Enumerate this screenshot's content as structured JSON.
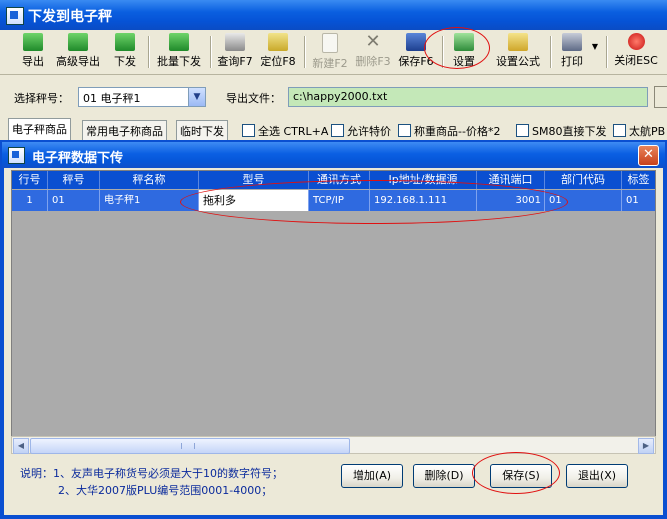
{
  "window": {
    "title": "下发到电子秤"
  },
  "toolbar": {
    "buttons": [
      {
        "label": "导出",
        "icon": "export-icon"
      },
      {
        "label": "高级导出",
        "icon": "advanced-export-icon"
      },
      {
        "label": "下发",
        "icon": "send-icon"
      },
      {
        "label": "批量下发",
        "icon": "batch-send-icon"
      },
      {
        "label": "查询F7",
        "icon": "binoculars-icon"
      },
      {
        "label": "定位F8",
        "icon": "locate-icon"
      },
      {
        "label": "新建F2",
        "icon": "new-document-icon"
      },
      {
        "label": "删除F3",
        "icon": "delete-x-icon"
      },
      {
        "label": "保存F6",
        "icon": "floppy-icon"
      },
      {
        "label": "设置",
        "icon": "settings-icon"
      },
      {
        "label": "设置公式",
        "icon": "formula-icon"
      },
      {
        "label": "打印",
        "icon": "printer-icon"
      },
      {
        "label": "关闭ESC",
        "icon": "close-circle-icon"
      }
    ]
  },
  "scale": {
    "label": "选择秤号：",
    "value": "01 电子秤1"
  },
  "export": {
    "label": "导出文件：",
    "value": "c:\\happy2000.txt"
  },
  "tabs": [
    {
      "label": "电子秤商品",
      "active": true
    },
    {
      "label": "常用电子称商品"
    },
    {
      "label": "临时下发"
    }
  ],
  "options": [
    {
      "label": "全选 CTRL+A"
    },
    {
      "label": "允许特价"
    },
    {
      "label": "称重商品--价格*2"
    },
    {
      "label": "SM80直接下发"
    },
    {
      "label": "太航PB"
    }
  ],
  "dialog": {
    "title": "电子秤数据下传",
    "close": "✕",
    "columns": [
      "行号",
      "秤号",
      "秤名称",
      "型号",
      "通讯方式",
      "Ip地址/数据源",
      "通讯端口",
      "部门代码",
      "标签"
    ],
    "rows": [
      [
        "1",
        "01",
        "电子秤1",
        "拖利多",
        "TCP/IP",
        "192.168.1.111",
        "3001",
        "01",
        "01"
      ]
    ],
    "notes": [
      "说明：1、友声电子称货号必须是大于10的数字符号；",
      "2、大华2007版PLU编号范围0001-4000；"
    ],
    "buttons": {
      "add": "增加(A)",
      "delete": "删除(D)",
      "save": "保存(S)",
      "exit": "退出(X)"
    }
  },
  "colors": {
    "title_blue": "#0a5fe0",
    "highlight": "#2f6ae0",
    "annotation_red": "#e01010",
    "export_field_bg": "#c4e8b8"
  }
}
